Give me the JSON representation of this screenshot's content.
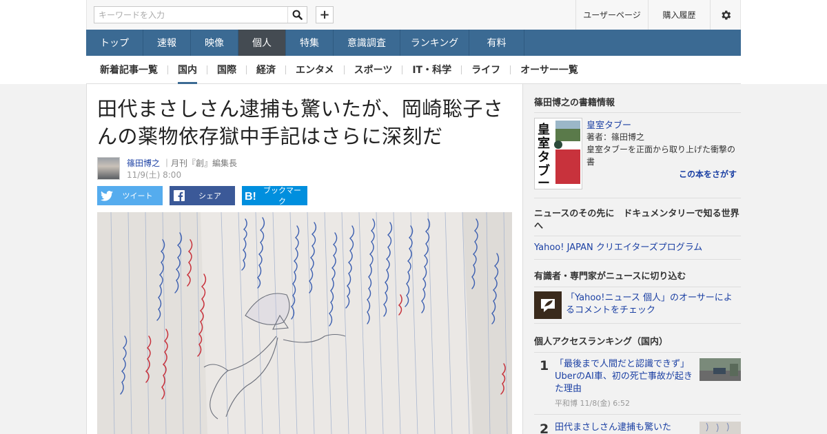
{
  "header": {
    "search_placeholder": "キーワードを入力",
    "search_icon": "search-icon",
    "add_label": "+",
    "user_page": "ユーザーページ",
    "purchase_history": "購入履歴",
    "settings_icon": "gear-icon"
  },
  "main_nav": [
    {
      "label": "トップ",
      "active": false
    },
    {
      "label": "速報",
      "active": false
    },
    {
      "label": "映像",
      "active": false
    },
    {
      "label": "個人",
      "active": true
    },
    {
      "label": "特集",
      "active": false
    },
    {
      "label": "意識調査",
      "active": false
    },
    {
      "label": "ランキング",
      "active": false
    },
    {
      "label": "有料",
      "active": false
    }
  ],
  "sub_nav": [
    {
      "label": "新着記事一覧",
      "active": false
    },
    {
      "label": "国内",
      "active": true
    },
    {
      "label": "国際",
      "active": false
    },
    {
      "label": "経済",
      "active": false
    },
    {
      "label": "エンタメ",
      "active": false
    },
    {
      "label": "スポーツ",
      "active": false
    },
    {
      "label": "IT・科学",
      "active": false
    },
    {
      "label": "ライフ",
      "active": false
    },
    {
      "label": "オーサー一覧",
      "active": false
    }
  ],
  "article": {
    "headline": "田代まさしさん逮捕も驚いたが、岡崎聡子さんの薬物依存獄中手記はさらに深刻だ",
    "author_name": "篠田博之",
    "author_role": "｜月刊『創』編集長",
    "date": "11/9(土) 8:00",
    "share": {
      "tweet": "ツイート",
      "share": "シェア",
      "bookmark": "ブックマーク"
    }
  },
  "sidebar": {
    "book_section_title": "篠田博之の書籍情報",
    "book_cover_text": "皇室タブー",
    "book_title": "皇室タブー",
    "book_author": "著者：篠田博之",
    "book_desc": "皇室タブーを正面から取り上げた衝撃の書",
    "book_find": "この本をさがす",
    "documentary_title": "ニュースのその先に　ドキュメンタリーで知る世界へ",
    "documentary_link": "Yahoo! JAPAN クリエイターズプログラム",
    "experts_title": "有識者・専門家がニュースに切り込む",
    "experts_link": "「Yahoo!ニュース 個人」のオーサーによるコメントをチェック",
    "ranking_title": "個人アクセスランキング（国内）",
    "ranking": [
      {
        "rank": "1",
        "title": "「最後まで人間だと認識できず」UberのAI車、初の死亡事故が起きた理由",
        "meta": "平和博  11/8(金) 6:52"
      },
      {
        "rank": "2",
        "title": "田代まさしさん逮捕も驚いた",
        "meta": ""
      }
    ]
  },
  "colors": {
    "nav_bg": "#3b6a93",
    "nav_active": "#444b52",
    "link": "#1a3fa3",
    "twitter": "#55acee",
    "facebook": "#3b5998",
    "hatena": "#008fde"
  }
}
